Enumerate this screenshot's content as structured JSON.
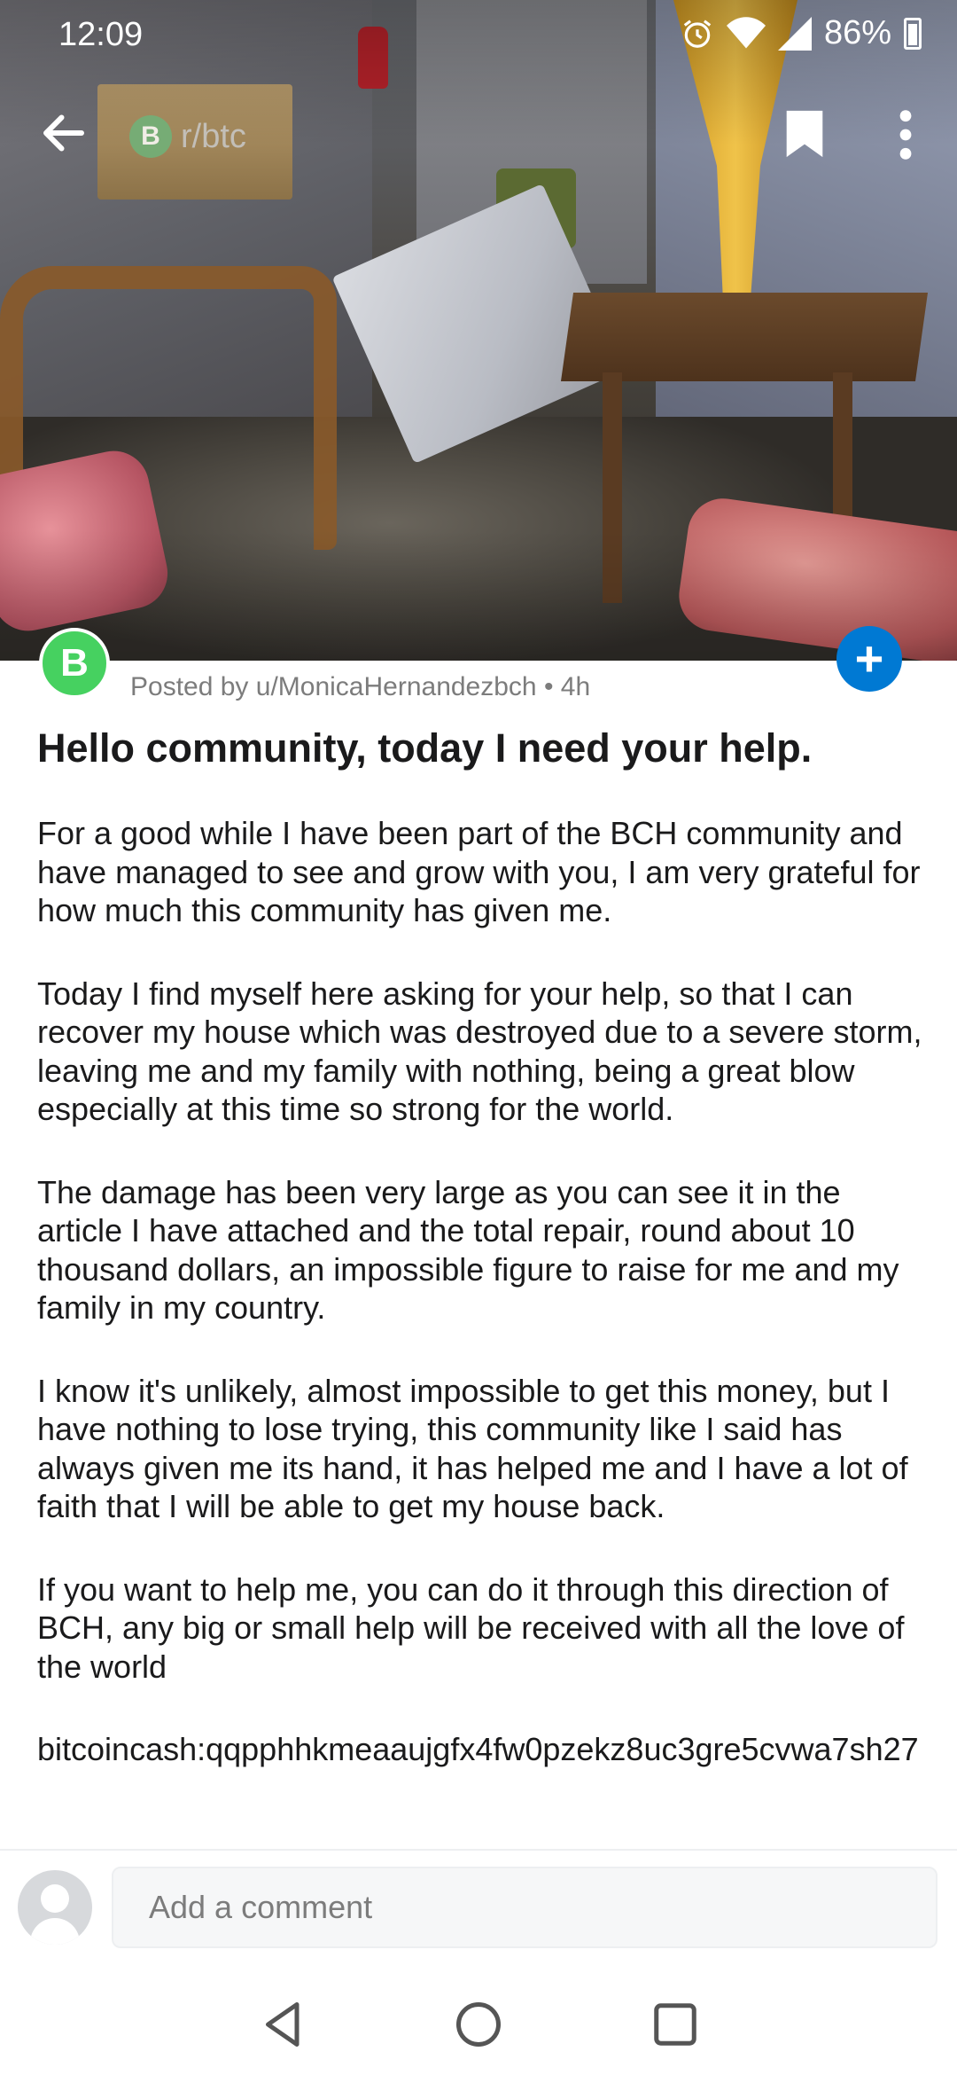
{
  "status_bar": {
    "time": "12:09",
    "battery": "86%"
  },
  "app_bar": {
    "subreddit": "r/btc",
    "subreddit_icon": "B"
  },
  "post": {
    "avatar_letter": "B",
    "meta": "Posted by u/MonicaHernandezbch • 4h",
    "title": "Hello community, today I need your help.",
    "paragraphs": [
      "For a good while I have been part of the BCH community and have managed to see and grow with you, I am very grateful for how much this community has given me.",
      "Today I find myself here asking for your help, so that I can recover my house which was destroyed due to a severe storm, leaving me and my family with nothing, being a great blow especially at this time so strong for the world.",
      "The damage has been very large as you can see it in the article I have attached and the total repair, round about 10 thousand dollars, an impossible figure to raise for me and my family in my country.",
      "I know it's unlikely, almost impossible to get this money, but I have nothing to lose trying, this community like I said has always given me its hand, it has helped me and I have a lot of faith that I will be able to get my house back.",
      "If you want to help me, you can do it through this direction of BCH, any big or small help will be received with all the love of the world",
      "bitcoincash:qqpphhkmeaaujgfx4fw0pzekz8uc3gre5cvwa7sh27"
    ]
  },
  "comment": {
    "placeholder": "Add a comment"
  },
  "colors": {
    "accent_blue": "#0079d3",
    "sub_green": "#46d160"
  },
  "icons": [
    "back-arrow-icon",
    "bookmark-icon",
    "more-vertical-icon",
    "alarm-icon",
    "wifi-icon",
    "signal-icon",
    "battery-icon",
    "nav-back-icon",
    "nav-home-icon",
    "nav-recents-icon"
  ]
}
